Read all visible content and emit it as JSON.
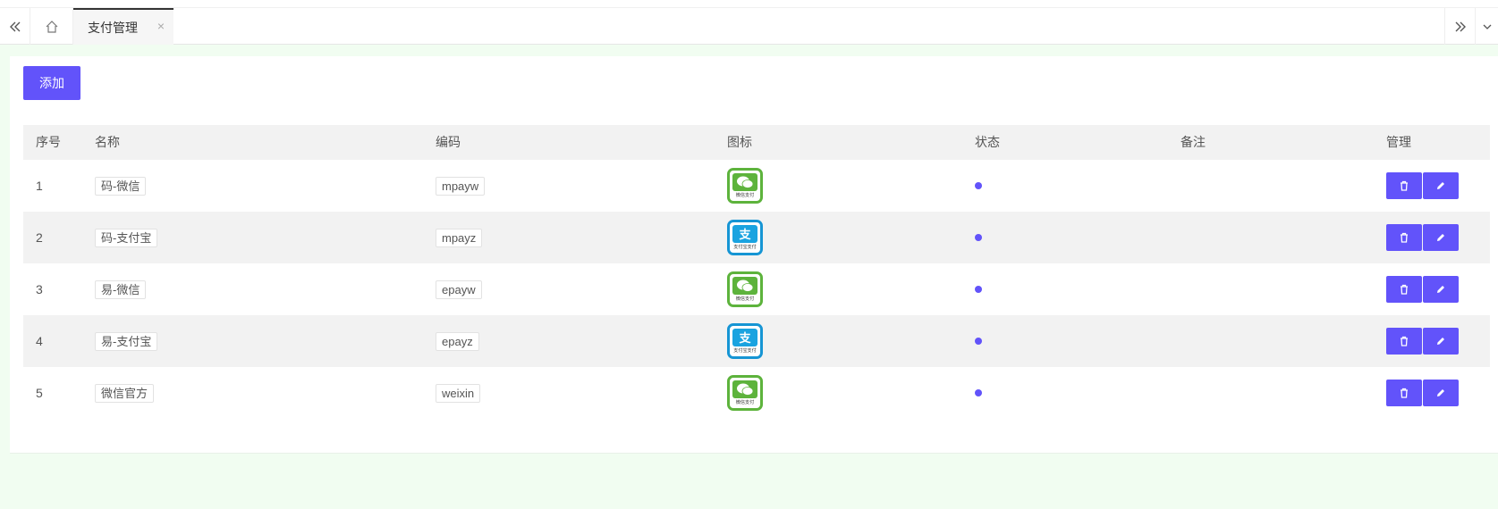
{
  "tabbar": {
    "active_tab": "支付管理",
    "close_glyph": "×"
  },
  "toolbar": {
    "add_label": "添加"
  },
  "table": {
    "headers": [
      "序号",
      "名称",
      "编码",
      "图标",
      "状态",
      "备注",
      "管理"
    ],
    "rows": [
      {
        "index": "1",
        "name": "码-微信",
        "code": "mpayw",
        "icon": "wechat-pay-icon",
        "icon_text": "微信支付",
        "status": "enabled",
        "remark": ""
      },
      {
        "index": "2",
        "name": "码-支付宝",
        "code": "mpayz",
        "icon": "alipay-icon",
        "icon_text": "支付宝支付",
        "status": "enabled",
        "remark": ""
      },
      {
        "index": "3",
        "name": "易-微信",
        "code": "epayw",
        "icon": "wechat-pay-icon",
        "icon_text": "微信支付",
        "status": "enabled",
        "remark": ""
      },
      {
        "index": "4",
        "name": "易-支付宝",
        "code": "epayz",
        "icon": "alipay-icon",
        "icon_text": "支付宝支付",
        "status": "enabled",
        "remark": ""
      },
      {
        "index": "5",
        "name": "微信官方",
        "code": "weixin",
        "icon": "wechat-pay-icon",
        "icon_text": "微信支付",
        "status": "enabled",
        "remark": ""
      }
    ]
  },
  "colors": {
    "accent": "#6253fa",
    "page_bg": "#f1fdf1",
    "wechat": "#5db33c",
    "alipay": "#1695d4"
  }
}
